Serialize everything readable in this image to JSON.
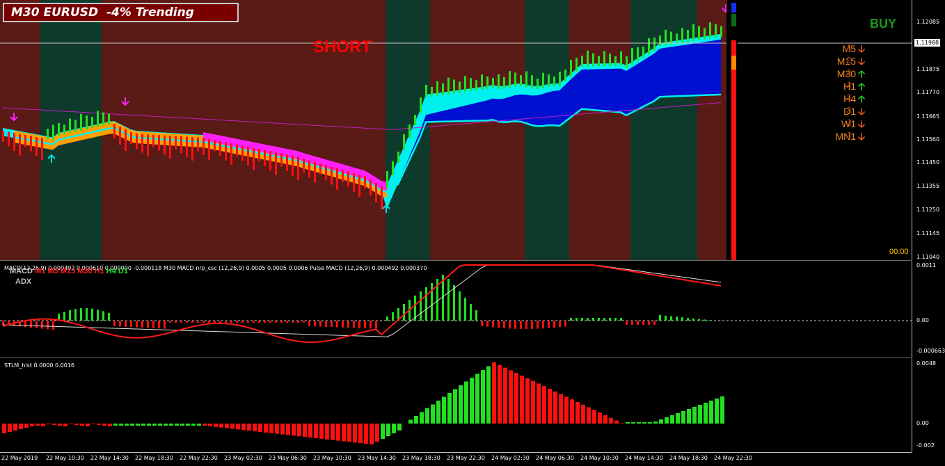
{
  "title": "M30 EURUSD  -4% Trending",
  "signal_text": "SHORT",
  "buy_text": "BUY",
  "time_left": "00:00",
  "current_price": "1.11988",
  "timeframes": [
    {
      "label": "M5",
      "dir": "down"
    },
    {
      "label": "M15",
      "dir": "down"
    },
    {
      "label": "M30",
      "dir": "up"
    },
    {
      "label": "H1",
      "dir": "up"
    },
    {
      "label": "H4",
      "dir": "up"
    },
    {
      "label": "D1",
      "dir": "down"
    },
    {
      "label": "W1",
      "dir": "down"
    },
    {
      "label": "MN1",
      "dir": "down"
    }
  ],
  "arrows": {
    "up": "🡡",
    "down": "🡣",
    "up_color": "#22e022",
    "down_color": "#ff5a14",
    "note_icon": "♫"
  },
  "price_axis": [
    "1.12085",
    "1.11988",
    "1.11875",
    "1.11770",
    "1.11665",
    "1.11560",
    "1.11450",
    "1.11355",
    "1.11250",
    "1.11145",
    "1.11040"
  ],
  "macd_header": "MACD(12,26,9) 0.000492 0.000610 0.000000 -0.000118  M30 MACD nrp_csc (12,26,9) 0.0005 0.0005 0.0006  Pulse MACD (12,26,9) 0.000492 0.000370",
  "macd_tf_labels": {
    "prefix": "MACD",
    "items": [
      {
        "t": "M1",
        "c": "#ff2020"
      },
      {
        "t": "M5",
        "c": "#ff2020"
      },
      {
        "t": "M15",
        "c": "#ff2020"
      },
      {
        "t": "M30",
        "c": "#ff2020"
      },
      {
        "t": "H1",
        "c": "#ff2020"
      },
      {
        "t": "H4",
        "c": "#22e022"
      },
      {
        "t": "D1",
        "c": "#22e022"
      }
    ],
    "adx": "ADX"
  },
  "macd_axis": [
    "0.0011",
    "0.00",
    "-0.000663"
  ],
  "stlm_header": "STLM_hist 0.0000 0.0016",
  "stlm_axis": [
    "0.0048",
    "0.00",
    "-0.002"
  ],
  "dates": [
    "22 May 2019",
    "22 May 10:30",
    "22 May 14:30",
    "22 May 18:30",
    "22 May 22:30",
    "23 May 02:30",
    "23 May 06:30",
    "23 May 10:30",
    "23 May 14:30",
    "23 May 18:30",
    "23 May 22:30",
    "24 May 02:30",
    "24 May 06:30",
    "24 May 10:30",
    "24 May 14:30",
    "24 May 18:30",
    "24 May 22:30"
  ],
  "colors": {
    "bull_bg": "#0e3a2c",
    "bear_bg": "#5a1a16",
    "bull": "#22e022",
    "bear": "#ff1010",
    "cloud_blue": "#0010d0",
    "cloud_cyan": "#00f0f0",
    "cloud_orange": "#ffa000",
    "cloud_magenta": "#ff20ff",
    "ma": "#c020c0"
  }
}
